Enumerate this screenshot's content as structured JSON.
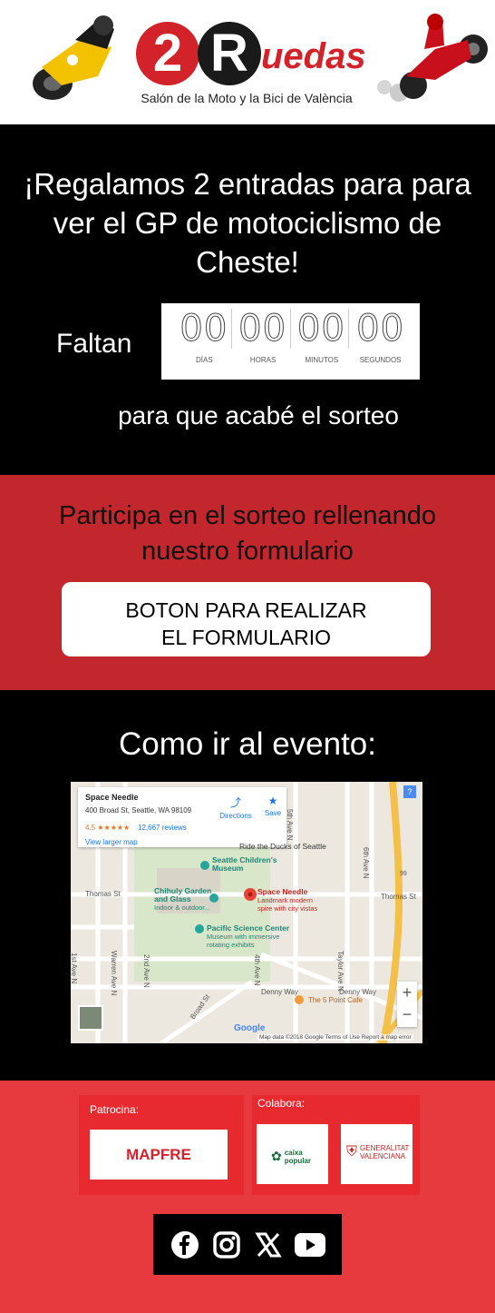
{
  "header": {
    "logo_number": "2",
    "logo_r": "R",
    "logo_word": "uedas",
    "subtitle": "Salón de la Moto y la Bici de València"
  },
  "countdown": {
    "headline": "¡Regalamos 2 entradas para para ver el GP de motociclismo de Cheste!",
    "prefix": "Faltan",
    "units": [
      {
        "value": "00",
        "label": "DÍAS"
      },
      {
        "value": "00",
        "label": "HORAS"
      },
      {
        "value": "00",
        "label": "MINUTOS"
      },
      {
        "value": "00",
        "label": "SEGUNDOS"
      }
    ],
    "suffix": "para que acabé el sorteo"
  },
  "participa": {
    "text": "Participa en el sorteo rellenando nuestro formulario",
    "button_line1": "BOTON PARA REALIZAR",
    "button_line2": "EL FORMULARIO"
  },
  "map_section": {
    "title": "Como ir al evento:",
    "card": {
      "name": "Space Needle",
      "address": "400 Broad St, Seattle, WA 98109",
      "rating": "4.5 ★★★★★",
      "reviews": "12,667 reviews",
      "larger_map": "View larger map",
      "directions": "Directions",
      "save": "Save"
    },
    "labels": {
      "ride_ducks": "Ride the Ducks of Seattle",
      "childrens_museum_1": "Seattle Children's",
      "childrens_museum_2": "Museum",
      "chihuly_1": "Chihuly Garden",
      "chihuly_2": "and Glass",
      "chihuly_3": "Indoor & outdoor...",
      "space_needle": "Space Needle",
      "space_needle_sub_1": "Landmark modern",
      "space_needle_sub_2": "spire with city vistas",
      "pacific_1": "Pacific Science Center",
      "pacific_2": "Museum with immersive",
      "pacific_3": "rotating exhibits",
      "thomas_st_1": "Thomas St",
      "thomas_st_2": "Thomas St",
      "denny_way_1": "Denny Way",
      "denny_way_2": "Denny Way",
      "five_point": "The 5 Point Cafe",
      "fifth_ave": "5th Ave N",
      "sixth_ave": "6th Ave N",
      "first_ave": "1st Ave N",
      "warren_ave": "Warren Ave N",
      "second_ave": "2nd Ave N",
      "fourth_ave": "4th Ave N",
      "taylor_ave": "Taylor Ave N",
      "broad_st": "Broad St",
      "route": "99",
      "google": "Google",
      "terms": "Map data ©2018 Google   Terms of Use   Report a map error",
      "help": "?",
      "zoom_in": "+",
      "zoom_out": "−"
    }
  },
  "sponsors": {
    "patrocina_label": "Patrocina:",
    "colabora_label": "Colabora:",
    "mapfre": "MAPFRE",
    "caixa_1": "caixa",
    "caixa_2": "popular",
    "gv_1": "GENERALITAT",
    "gv_2": "VALENCIANA"
  },
  "social": [
    "facebook-icon",
    "instagram-icon",
    "x-icon",
    "youtube-icon"
  ],
  "colors": {
    "brand_red": "#d2232a",
    "participa_bg": "#c1272d",
    "sponsors_bg": "#e63a3f"
  }
}
